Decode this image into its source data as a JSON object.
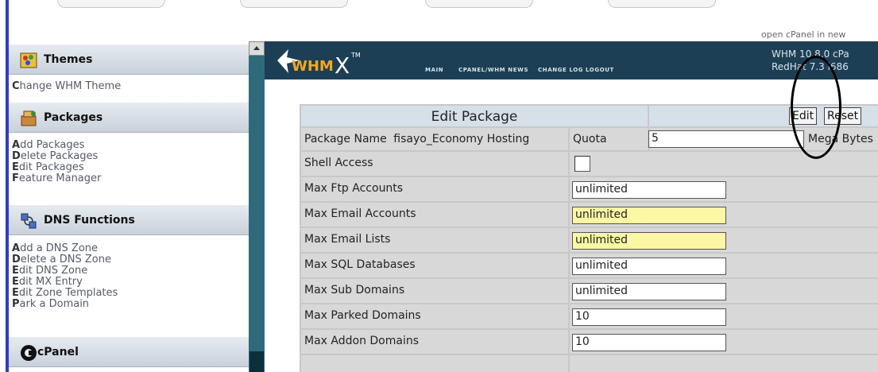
{
  "header_hint": "open cPanel in new",
  "sidebar": {
    "sections": [
      {
        "title": "Themes",
        "icon": "themes-icon",
        "links": [
          "Change WHM Theme"
        ]
      },
      {
        "title": "Packages",
        "icon": "packages-icon",
        "links": [
          "Add Packages",
          "Delete Packages",
          "Edit Packages",
          "Feature Manager"
        ]
      },
      {
        "title": "DNS Functions",
        "icon": "dns-functions-icon",
        "links": [
          "Add a DNS Zone",
          "Delete a DNS Zone",
          "Edit DNS Zone",
          "Edit MX Entry",
          "Edit Zone Templates",
          "Park a Domain"
        ]
      },
      {
        "title": "cPanel",
        "icon": "cpanel-logo-icon",
        "links": []
      }
    ]
  },
  "whm": {
    "logo": "WHM",
    "logo_x": "X",
    "logo_tm": "TM",
    "nav": [
      "MAIN",
      "CPANEL/WHM NEWS",
      "CHANGE LOG",
      "LOGOUT"
    ],
    "version_line1": "WHM 10.8.0 cPa",
    "version_line2": "RedHat 7.3 i686"
  },
  "edit_package": {
    "title": "Edit Package",
    "edit_button": "Edit",
    "reset_button": "Reset",
    "package_name_label": "Package Name",
    "package_name_value": "fisayo_Economy Hosting",
    "quota_label": "Quota",
    "quota_value": "5",
    "quota_unit": "Mega Bytes",
    "rows": [
      {
        "label": "Shell Access",
        "type": "checkbox",
        "checked": false
      },
      {
        "label": "Max Ftp Accounts",
        "type": "input",
        "value": "unlimited",
        "highlight": false
      },
      {
        "label": "Max Email Accounts",
        "type": "input",
        "value": "unlimited",
        "highlight": true
      },
      {
        "label": "Max Email Lists",
        "type": "input",
        "value": "unlimited",
        "highlight": true
      },
      {
        "label": "Max SQL Databases",
        "type": "input",
        "value": "unlimited",
        "highlight": false
      },
      {
        "label": "Max Sub Domains",
        "type": "input",
        "value": "unlimited",
        "highlight": false
      },
      {
        "label": "Max Parked Domains",
        "type": "input",
        "value": "10",
        "highlight": false
      },
      {
        "label": "Max Addon Domains",
        "type": "input",
        "value": "10",
        "highlight": false
      }
    ]
  },
  "colors": {
    "header_bg": "#1d3f55",
    "highlight_input": "#fdf6a4",
    "scrollbar": "#2f6a7a"
  }
}
